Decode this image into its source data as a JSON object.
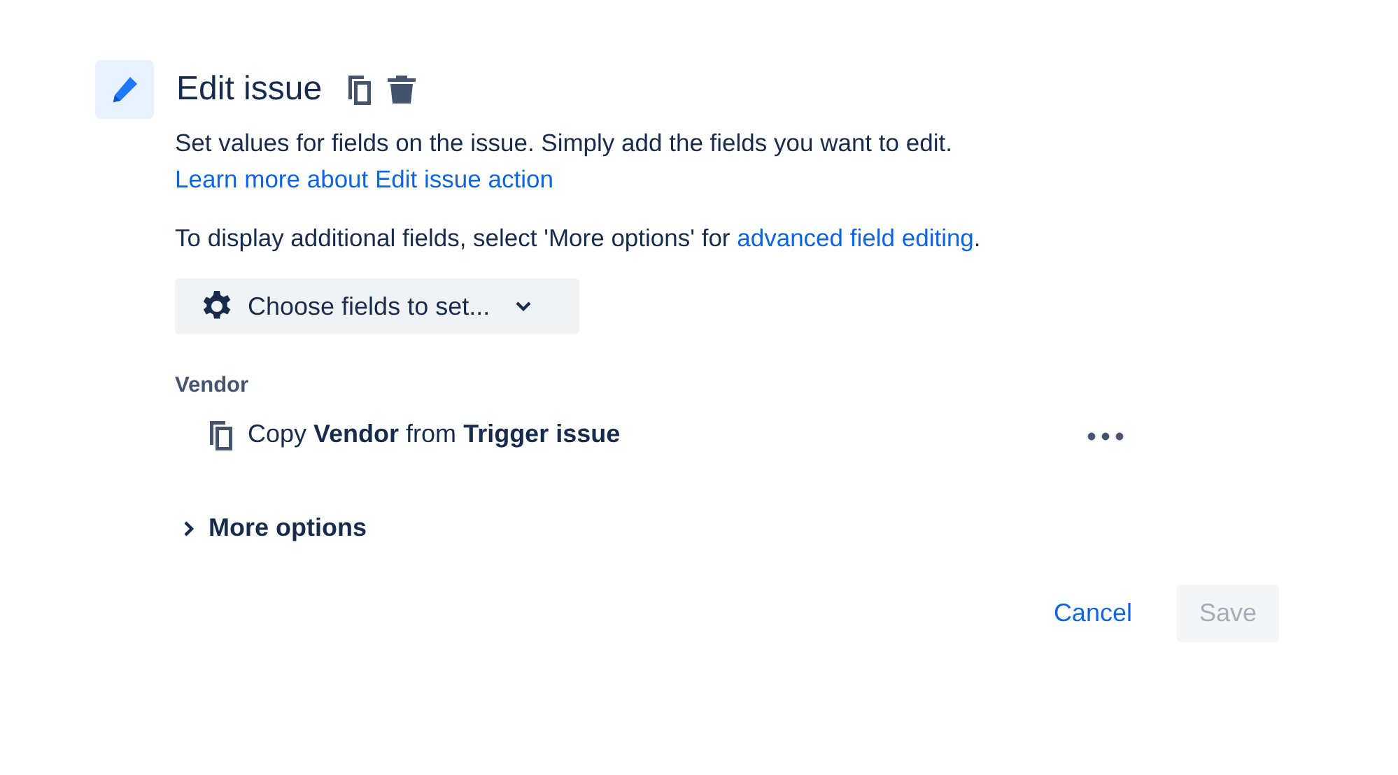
{
  "header": {
    "title": "Edit issue"
  },
  "intro": {
    "text": "Set values for fields on the issue. Simply add the fields you want to edit.",
    "link": "Learn more about Edit issue action"
  },
  "hint": {
    "text": "To display additional fields, select 'More options' for",
    "link": "advanced field editing",
    "suffix": "."
  },
  "field_picker": {
    "label": "Choose fields to set..."
  },
  "fields": [
    {
      "label": "Vendor",
      "action": "Copy **Vendor** from **Trigger issue**"
    }
  ],
  "more_options": {
    "label": "More options",
    "expanded": false
  },
  "actions": [
    {
      "label": "Cancel",
      "kind": "link",
      "disabled": false
    },
    {
      "label": "Save",
      "kind": "primary",
      "disabled": true
    }
  ]
}
